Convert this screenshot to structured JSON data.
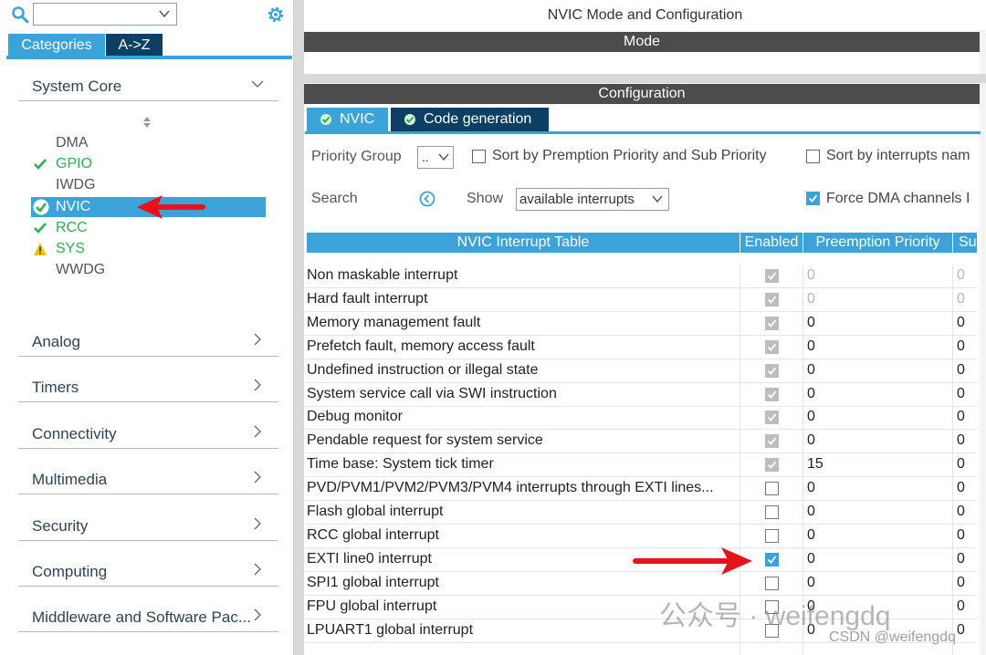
{
  "left": {
    "category_value": "",
    "tabs": [
      "Categories",
      "A->Z"
    ],
    "categories": [
      "System Core",
      "Analog",
      "Timers",
      "Connectivity",
      "Multimedia",
      "Security",
      "Computing",
      "Middleware and Software Pac..."
    ],
    "system_core_items": [
      {
        "label": "DMA",
        "status": "none"
      },
      {
        "label": "GPIO",
        "status": "ok"
      },
      {
        "label": "IWDG",
        "status": "none"
      },
      {
        "label": "NVIC",
        "status": "ok-selected"
      },
      {
        "label": "RCC",
        "status": "ok"
      },
      {
        "label": "SYS",
        "status": "warning"
      },
      {
        "label": "WWDG",
        "status": "none"
      }
    ]
  },
  "right": {
    "title": "NVIC Mode and Configuration",
    "mode_header": "Mode",
    "config_header": "Configuration",
    "tabs": [
      "NVIC",
      "Code generation"
    ],
    "priority_group_label": "Priority Group",
    "priority_group_value": "..",
    "sort_premption_label": "Sort by Premption Priority and Sub Priority",
    "sort_interrupts_label": "Sort by interrupts nam",
    "search_label": "Search",
    "show_label": "Show",
    "show_value": "available interrupts",
    "force_dma_label": "Force DMA channels I",
    "table": {
      "headers": [
        "NVIC Interrupt Table",
        "Enabled",
        "Preemption Priority",
        "Su"
      ],
      "rows": [
        {
          "name": "Non maskable interrupt",
          "enabled": "forced",
          "pre": "0",
          "sub": "0",
          "muted": true
        },
        {
          "name": "Hard fault interrupt",
          "enabled": "forced",
          "pre": "0",
          "sub": "0",
          "muted": true
        },
        {
          "name": "Memory management fault",
          "enabled": "forced",
          "pre": "0",
          "sub": "0",
          "muted": false
        },
        {
          "name": "Prefetch fault, memory access fault",
          "enabled": "forced",
          "pre": "0",
          "sub": "0",
          "muted": false
        },
        {
          "name": "Undefined instruction or illegal state",
          "enabled": "forced",
          "pre": "0",
          "sub": "0",
          "muted": false
        },
        {
          "name": "System service call via SWI instruction",
          "enabled": "forced",
          "pre": "0",
          "sub": "0",
          "muted": false
        },
        {
          "name": "Debug monitor",
          "enabled": "forced",
          "pre": "0",
          "sub": "0",
          "muted": false
        },
        {
          "name": "Pendable request for system service",
          "enabled": "forced",
          "pre": "0",
          "sub": "0",
          "muted": false
        },
        {
          "name": "Time base: System tick timer",
          "enabled": "forced",
          "pre": "15",
          "sub": "0",
          "muted": false
        },
        {
          "name": "PVD/PVM1/PVM2/PVM3/PVM4 interrupts through EXTI lines...",
          "enabled": "off",
          "pre": "0",
          "sub": "0",
          "muted": false
        },
        {
          "name": "Flash global interrupt",
          "enabled": "off",
          "pre": "0",
          "sub": "0",
          "muted": false
        },
        {
          "name": "RCC global interrupt",
          "enabled": "off",
          "pre": "0",
          "sub": "0",
          "muted": false
        },
        {
          "name": "EXTI line0 interrupt",
          "enabled": "on",
          "pre": "0",
          "sub": "0",
          "muted": false
        },
        {
          "name": "SPI1 global interrupt",
          "enabled": "off",
          "pre": "0",
          "sub": "0",
          "muted": false
        },
        {
          "name": "FPU global interrupt",
          "enabled": "off",
          "pre": "0",
          "sub": "0",
          "muted": false
        },
        {
          "name": "LPUART1 global interrupt",
          "enabled": "off",
          "pre": "0",
          "sub": "0",
          "muted": false
        }
      ]
    }
  },
  "watermark": {
    "wechat": "公众号 · weifengdq",
    "csdn": "CSDN @weifengdq"
  },
  "colors": {
    "accent": "#3ba3d8",
    "dark_tab": "#0d3f64",
    "band": "#4c4c4c",
    "ok_green": "#2bb24c",
    "warning_yellow": "#f2c200",
    "annotation_red": "#e8121b"
  }
}
